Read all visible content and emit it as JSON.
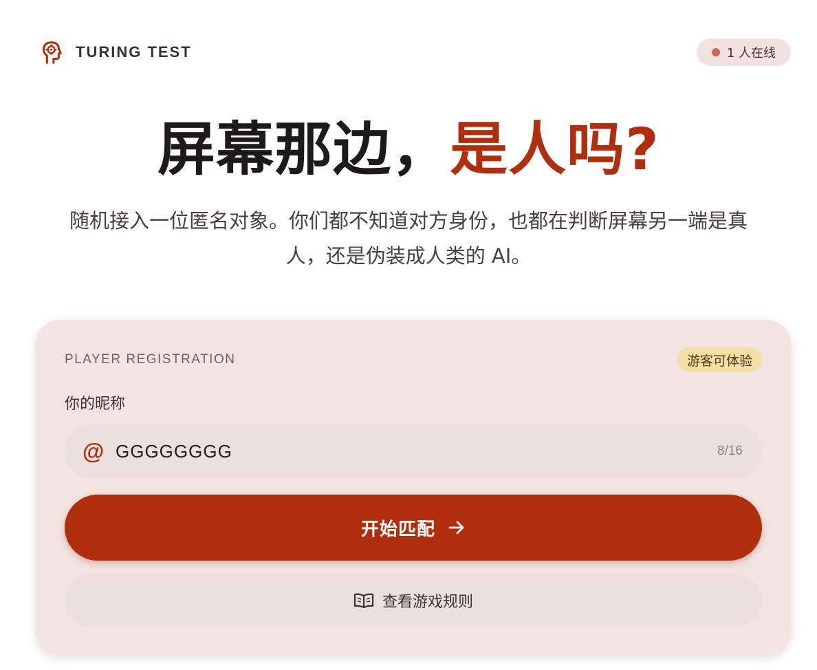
{
  "header": {
    "brand_icon": "head-gear-icon",
    "brand_name": "TURING TEST",
    "online_text": "1 人在线"
  },
  "hero": {
    "title_main": "屏幕那边，",
    "title_accent": "是人吗?",
    "description": "随机接入一位匿名对象。你们都不知道对方身份，也都在判断屏幕另一端是真人，还是伪装成人类的 AI。"
  },
  "card": {
    "section_label": "PLAYER REGISTRATION",
    "guest_badge": "游客可体验",
    "nickname_label": "你的昵称",
    "nickname_icon": "at-icon",
    "nickname_value": "GGGGGGGG",
    "char_count": "8/16",
    "start_button": "开始匹配",
    "start_icon": "arrow-right-icon",
    "rules_button": "查看游戏规则",
    "rules_icon": "book-icon"
  },
  "colors": {
    "accent": "#b02e0c",
    "card_bg": "#f2e4e1",
    "badge_bg": "#f6dfa4",
    "online_dot": "#cf6a4e"
  }
}
